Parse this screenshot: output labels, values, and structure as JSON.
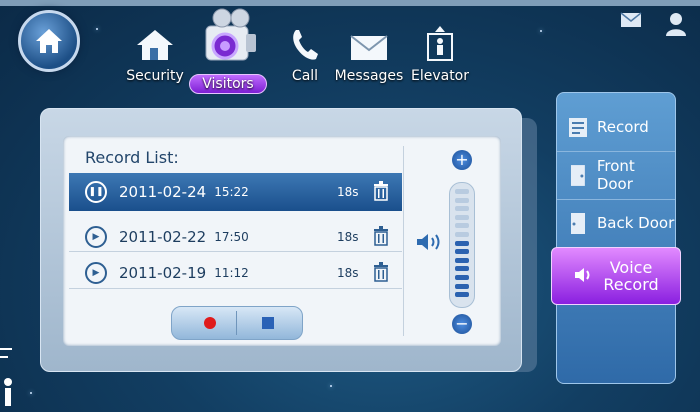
{
  "nav": {
    "items": [
      {
        "label": "Security",
        "icon": "house-icon"
      },
      {
        "label": "Visitors",
        "icon": "camera-icon",
        "active": true
      },
      {
        "label": "Call",
        "icon": "phone-icon"
      },
      {
        "label": "Messages",
        "icon": "envelope-icon"
      },
      {
        "label": "Elevator",
        "icon": "elevator-icon"
      }
    ]
  },
  "record_list": {
    "title": "Record List:",
    "rows": [
      {
        "date": "2011-02-24",
        "time": "15:22",
        "duration": "18s",
        "selected": true,
        "state": "paused"
      },
      {
        "date": "2011-02-22",
        "time": "17:50",
        "duration": "18s",
        "selected": false,
        "state": "play"
      },
      {
        "date": "2011-02-19",
        "time": "11:12",
        "duration": "18s",
        "selected": false,
        "state": "play"
      }
    ]
  },
  "volume": {
    "level": 0.5,
    "segments": 13
  },
  "side_menu": {
    "items": [
      {
        "label": "Record",
        "icon": "record-book-icon"
      },
      {
        "label": "Front Door",
        "icon": "front-door-icon"
      },
      {
        "label": "Back Door",
        "icon": "back-door-icon"
      },
      {
        "label_line1": "Voice",
        "label_line2": "Record",
        "icon": "voice-record-icon",
        "active": true
      }
    ]
  },
  "colors": {
    "accent": "#9b38ea",
    "selected_row": "#1a4f8c",
    "record": "#e01b1b"
  }
}
